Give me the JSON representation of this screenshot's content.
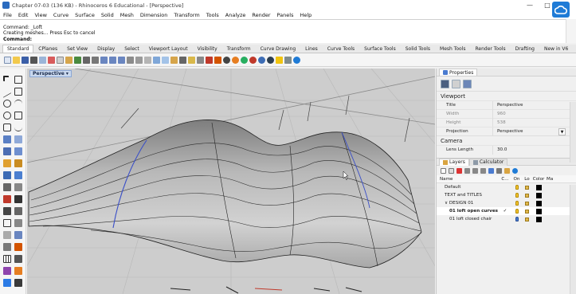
{
  "window": {
    "title": "Chapter 07-03 (136 KB) - Rhinoceros 6 Educational - [Perspective]",
    "controls": [
      "—",
      "□",
      "✕"
    ]
  },
  "menu": [
    "File",
    "Edit",
    "View",
    "Curve",
    "Surface",
    "Solid",
    "Mesh",
    "Dimension",
    "Transform",
    "Tools",
    "Analyze",
    "Render",
    "Panels",
    "Help"
  ],
  "command_history": {
    "line1": "Command: _Loft",
    "line2": "Creating meshes... Press Esc to cancel",
    "prompt": "Command:"
  },
  "toolbar_tabs": [
    "Standard",
    "CPlanes",
    "Set View",
    "Display",
    "Select",
    "Viewport Layout",
    "Visibility",
    "Transform",
    "Curve Drawing",
    "Lines",
    "Curve Tools",
    "Surface Tools",
    "Solid Tools",
    "Mesh Tools",
    "Render Tools",
    "Drafting",
    "New in V6"
  ],
  "viewport": {
    "label": "Perspective",
    "label_arrow": "▾"
  },
  "properties": {
    "tab_label": "Properties",
    "section_viewport": "Viewport",
    "rows": [
      {
        "key": "Title",
        "value": "Perspective"
      },
      {
        "key": "Width",
        "value": "960"
      },
      {
        "key": "Height",
        "value": "538"
      },
      {
        "key": "Projection",
        "value": "Perspective"
      }
    ],
    "section_camera": "Camera",
    "lens_key": "Lens Length",
    "lens_value": "30.0"
  },
  "layers": {
    "tab_layers": "Layers",
    "tab_calculator": "Calculator",
    "headers": {
      "name": "Name",
      "current": "C...",
      "on": "On",
      "lock": "Lo",
      "color": "Color",
      "material": "Ma"
    },
    "rows": [
      {
        "name": "Default",
        "current": "",
        "on": "yellow",
        "color": "#000000"
      },
      {
        "name": "TEXT and TITLES",
        "current": "",
        "on": "yellow",
        "color": "#000000"
      },
      {
        "name": "∨ DESIGN 01",
        "current": "",
        "on": "yellow",
        "color": "#000000"
      },
      {
        "name": "01 loft open curves",
        "current": "✓",
        "on": "yellow",
        "color": "#000000"
      },
      {
        "name": "01 loft closed chair",
        "current": "",
        "on": "blue",
        "color": "#000000"
      }
    ]
  },
  "colors": {
    "accent": "#1f7bd6",
    "surface": "#a9a9a9",
    "grid_bg": "#cfcfcf"
  }
}
